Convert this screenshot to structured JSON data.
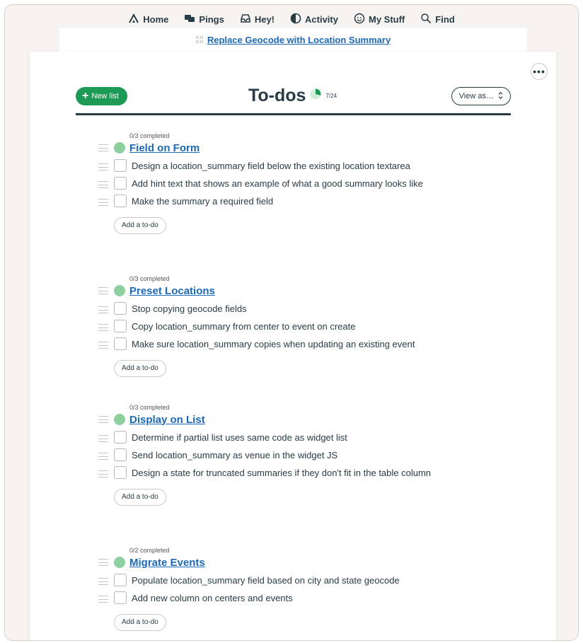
{
  "nav": {
    "items": [
      {
        "label": "Home",
        "icon": "home-icon"
      },
      {
        "label": "Pings",
        "icon": "pings-icon"
      },
      {
        "label": "Hey!",
        "icon": "hey-icon"
      },
      {
        "label": "Activity",
        "icon": "activity-icon"
      },
      {
        "label": "My Stuff",
        "icon": "my-stuff-icon"
      },
      {
        "label": "Find",
        "icon": "search-icon"
      }
    ]
  },
  "breadcrumb": {
    "label": "Replace Geocode with Location Summary"
  },
  "header": {
    "new_list_label": "New list",
    "title": "To-dos",
    "progress": "7/24",
    "progress_fraction": 0.29,
    "view_as_label": "View as…"
  },
  "lists": [
    {
      "completed": "0/3 completed",
      "title": "Field on Form",
      "todos": [
        "Design a location_summary field below the existing location textarea",
        "Add hint text that shows an example of what a good summary looks like",
        "Make the summary a required field"
      ],
      "add_label": "Add a to-do"
    },
    {
      "completed": "0/3 completed",
      "title": "Preset Locations",
      "todos": [
        "Stop copying geocode fields",
        "Copy location_summary from center to event on create",
        "Make sure location_summary copies when updating an existing event"
      ],
      "add_label": "Add a to-do"
    },
    {
      "completed": "0/3 completed",
      "title": "Display on List",
      "todos": [
        "Determine if partial list uses same code as widget list",
        "Send location_summary as venue in the widget JS",
        "Design a state for truncated summaries if they don't fit in the table column"
      ],
      "add_label": "Add a to-do"
    },
    {
      "completed": "0/2 completed",
      "title": "Migrate Events",
      "todos": [
        "Populate location_summary field based on city and state geocode",
        "Add new column on centers and events"
      ],
      "add_label": "Add a to-do"
    }
  ],
  "colors": {
    "accent_green": "#1d9a55",
    "link_blue": "#1d69b5",
    "text_dark": "#283c46",
    "list_dot": "#8dcf9f"
  }
}
